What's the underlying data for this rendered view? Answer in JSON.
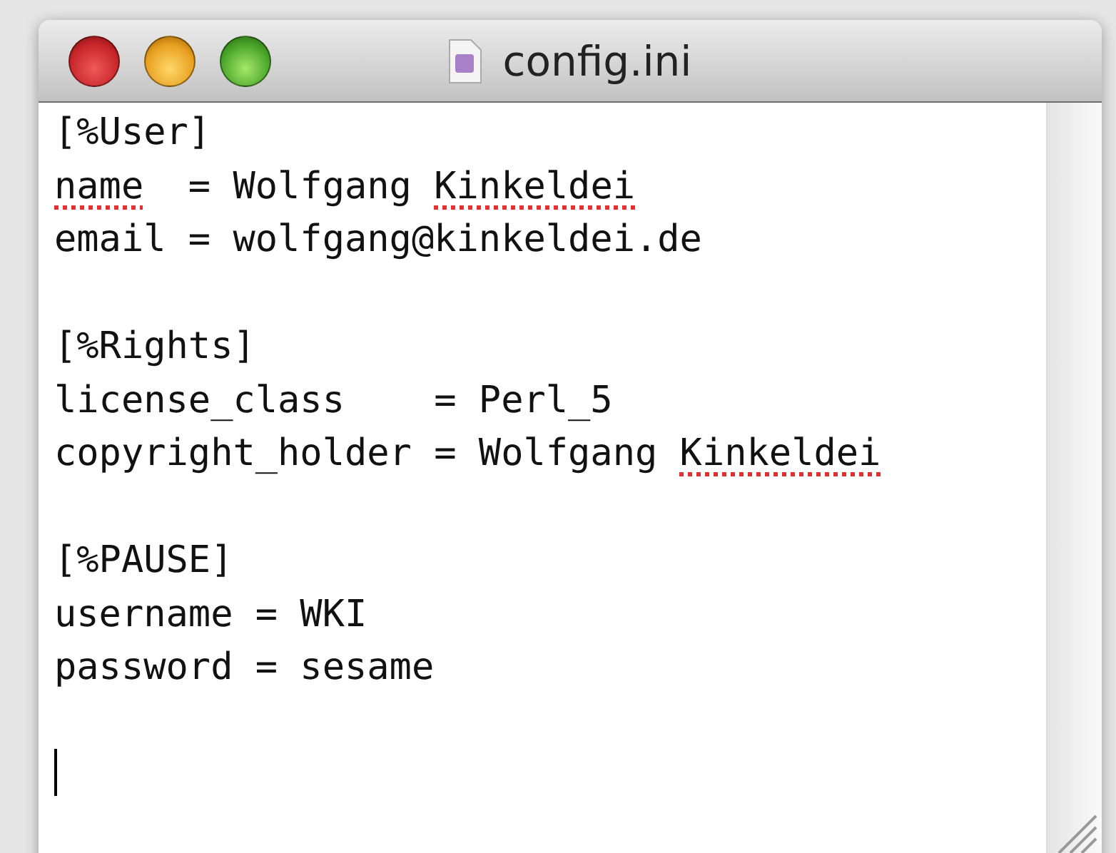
{
  "window": {
    "title": "config.ini"
  },
  "editor": {
    "sections": [
      {
        "lines": [
          {
            "segments": [
              {
                "text": "[%User]",
                "misspelled": false
              }
            ]
          },
          {
            "segments": [
              {
                "text": "name",
                "misspelled": true
              },
              {
                "text": "  = Wolfgang ",
                "misspelled": false
              },
              {
                "text": "Kinkeldei",
                "misspelled": true
              }
            ]
          },
          {
            "segments": [
              {
                "text": "email = wolfgang@kinkeldei.de",
                "misspelled": false
              }
            ]
          }
        ]
      },
      {
        "lines": [
          {
            "segments": [
              {
                "text": "[%Rights]",
                "misspelled": false
              }
            ]
          },
          {
            "segments": [
              {
                "text": "license_class    = Perl_5",
                "misspelled": false
              }
            ]
          },
          {
            "segments": [
              {
                "text": "copyright_holder = Wolfgang ",
                "misspelled": false
              },
              {
                "text": "Kinkeldei",
                "misspelled": true
              }
            ]
          }
        ]
      },
      {
        "lines": [
          {
            "segments": [
              {
                "text": "[%PAUSE]",
                "misspelled": false
              }
            ]
          },
          {
            "segments": [
              {
                "text": "username = WKI",
                "misspelled": false
              }
            ]
          },
          {
            "segments": [
              {
                "text": "password = sesame",
                "misspelled": false
              }
            ]
          }
        ]
      }
    ],
    "caret": true
  }
}
